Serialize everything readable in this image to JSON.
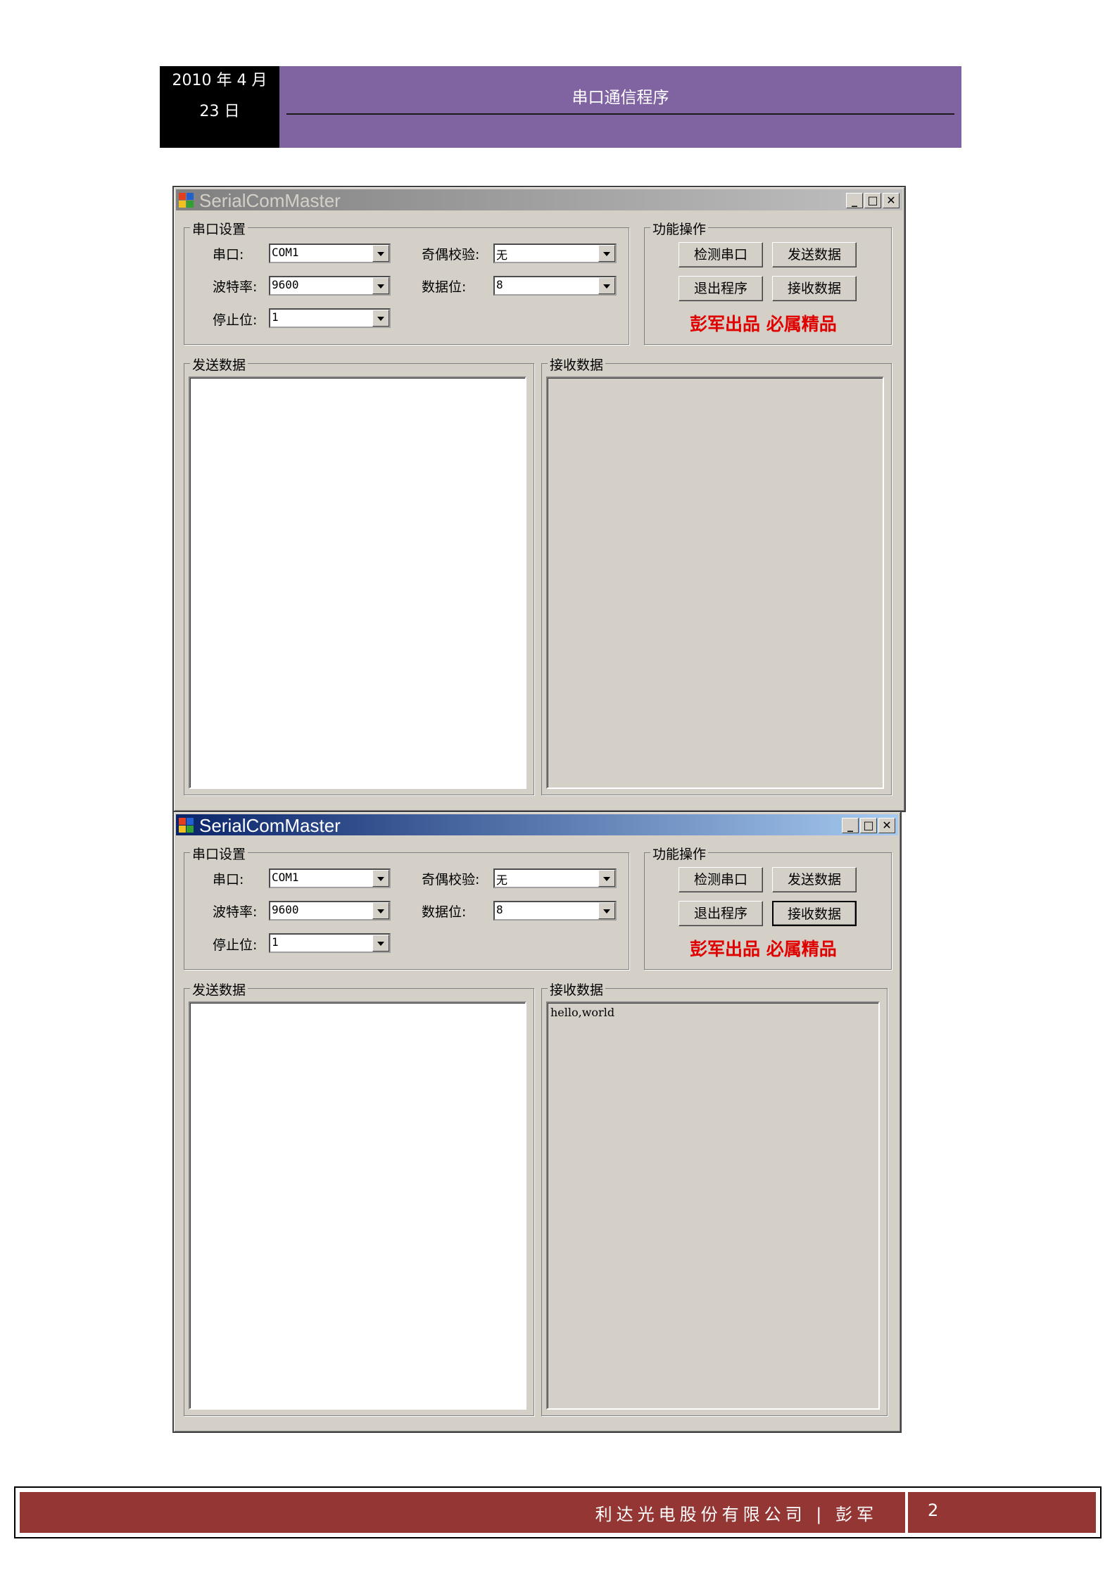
{
  "header": {
    "date_line1": "2010 年 4 月",
    "date_line2": "23 日",
    "title": "串口通信程序"
  },
  "windows": [
    {
      "title": "SerialComMaster",
      "state": "inactive",
      "serial_group": {
        "label": "串口设置",
        "port_label": "串口:",
        "port_value": "COM1",
        "baud_label": "波特率:",
        "baud_value": "9600",
        "stop_label": "停止位:",
        "stop_value": "1",
        "parity_label": "奇偶校验:",
        "parity_value": "无",
        "databits_label": "数据位:",
        "databits_value": "8"
      },
      "func_group": {
        "label": "功能操作",
        "detect_port": "检测串口",
        "send_data": "发送数据",
        "exit_program": "退出程序",
        "receive_data": "接收数据",
        "slogan": "彭军出品 必属精品"
      },
      "send_group": {
        "label": "发送数据",
        "text": ""
      },
      "receive_group": {
        "label": "接收数据",
        "text": ""
      }
    },
    {
      "title": "SerialComMaster",
      "state": "active",
      "serial_group": {
        "label": "串口设置",
        "port_label": "串口:",
        "port_value": "COM1",
        "baud_label": "波特率:",
        "baud_value": "9600",
        "stop_label": "停止位:",
        "stop_value": "1",
        "parity_label": "奇偶校验:",
        "parity_value": "无",
        "databits_label": "数据位:",
        "databits_value": "8"
      },
      "func_group": {
        "label": "功能操作",
        "detect_port": "检测串口",
        "send_data": "发送数据",
        "exit_program": "退出程序",
        "receive_data": "接收数据",
        "slogan": "彭军出品 必属精品"
      },
      "send_group": {
        "label": "发送数据",
        "text": ""
      },
      "receive_group": {
        "label": "接收数据",
        "text": "hello,world"
      }
    }
  ],
  "footer": {
    "company": "利达光电股份有限公司 | 彭军",
    "page_number": "2"
  },
  "colors": {
    "header_purple": "#8064a2",
    "footer_red": "#943634",
    "window_face": "#d4d0c8",
    "slogan_red": "#e00000"
  }
}
